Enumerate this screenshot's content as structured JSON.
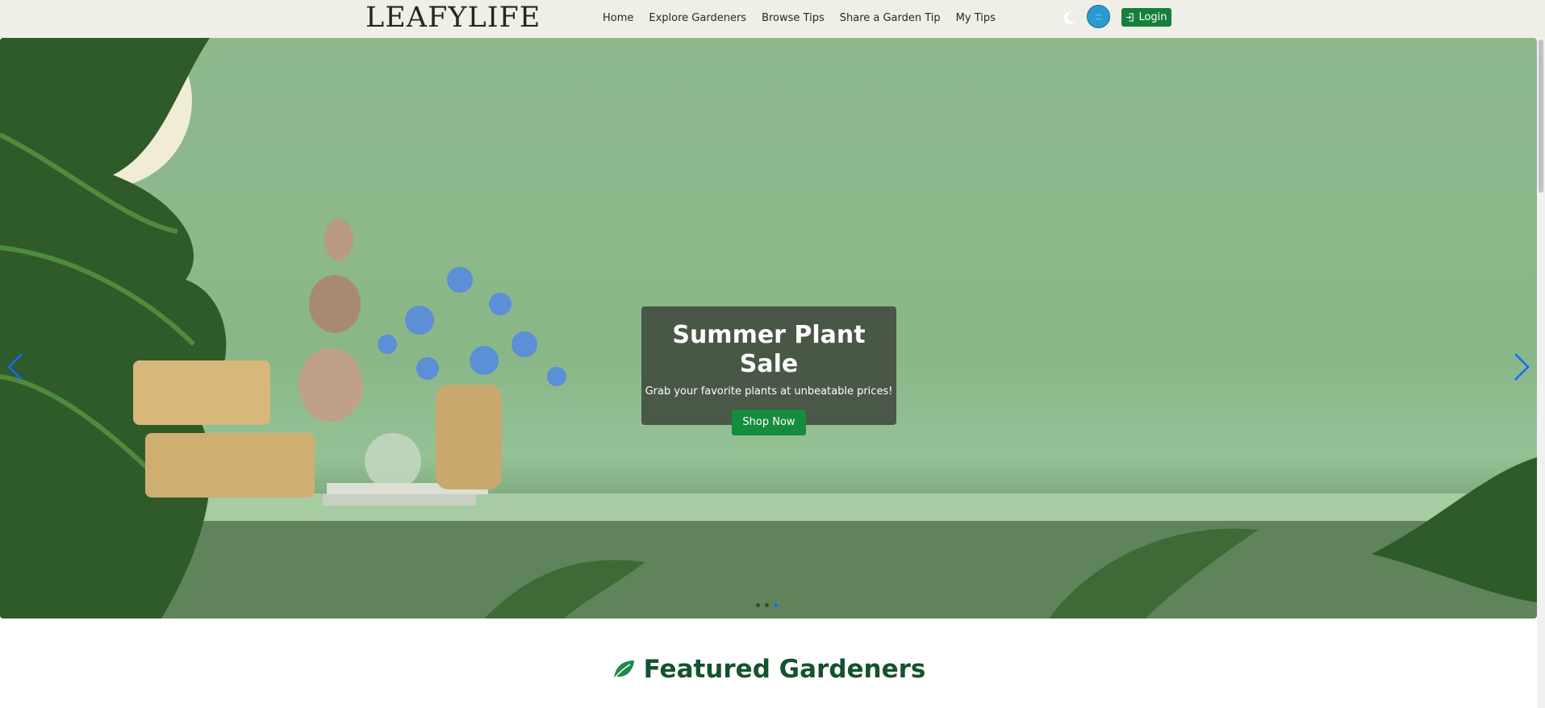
{
  "navbar": {
    "logo": "LEAFYLIFE",
    "links": [
      "Home",
      "Explore Gardeners",
      "Browse Tips",
      "Share a Garden Tip",
      "My Tips"
    ],
    "theme_toggle_icon": "moon-icon",
    "avatar_icon": "user-avatar",
    "login_label": "Login",
    "login_icon": "sign-in-icon",
    "background": "#efefe8",
    "accent": "#157f3b"
  },
  "hero": {
    "title": "Summer Plant Sale",
    "subtitle": "Grab your favorite plants at unbeatable prices!",
    "cta_label": "Shop Now",
    "slide_count": 3,
    "active_slide": 3,
    "prev_icon": "chevron-left-icon",
    "next_icon": "chevron-right-icon"
  },
  "featured": {
    "heading": "Featured Gardeners",
    "icon": "leaf-icon",
    "color": "#14532d"
  }
}
